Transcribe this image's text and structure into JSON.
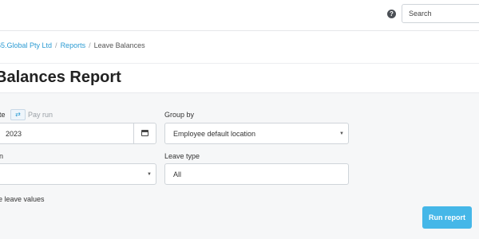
{
  "topbar": {
    "help_glyph": "?",
    "search_placeholder": "Search",
    "help_icon": "question-circle-icon"
  },
  "breadcrumb": {
    "items": [
      "65.Global Pty Ltd",
      "Reports"
    ],
    "separator": "/",
    "current": "Leave Balances"
  },
  "page": {
    "title": "Balances Report"
  },
  "form": {
    "date_label": "te",
    "date_toggle_icon": "swap-arrows-icon",
    "pay_run_label": "Pay run",
    "date_value": "2023",
    "group_by_label": "Group by",
    "group_by_value": "Employee default location",
    "location_label": "n",
    "location_value": "",
    "leave_type_label": "Leave type",
    "leave_type_value": "All",
    "leave_values_text": "e leave values"
  },
  "actions": {
    "run_report_label": "Run report"
  },
  "colors": {
    "accent": "#2b9bd3",
    "button": "#45b7e8"
  }
}
